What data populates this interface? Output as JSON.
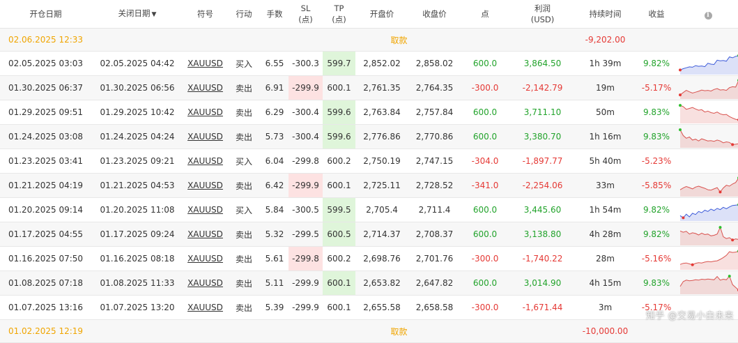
{
  "headers": {
    "open_date": "开仓日期",
    "close_date": "关闭日期",
    "close_date_sort_icon": "caret-down-icon",
    "symbol": "符号",
    "action": "行动",
    "lots": "手数",
    "sl_line1": "SL",
    "sl_line2": "(点)",
    "tp_line1": "TP",
    "tp_line2": "(点)",
    "open_price": "开盘价",
    "close_price": "收盘价",
    "points": "点",
    "profit_line1": "利润",
    "profit_line2": "(USD)",
    "duration": "持续时间",
    "gain": "收益",
    "info_icon": "info-icon",
    "info_glyph": "i"
  },
  "colors": {
    "positive": "#22a32b",
    "negative": "#e53935",
    "pending": "#f0a500",
    "sl_highlight": "#fde2e2",
    "tp_highlight": "#dff5da",
    "sparkline_up": "#3d5bd9",
    "sparkline_down": "#d9534f"
  },
  "pending_top": {
    "open": "02.06.2025 12:33",
    "action": "取款",
    "profit": "-9,202.00",
    "icon": "chat-bubble-icon"
  },
  "trades": [
    {
      "open": "02.05.2025 03:03",
      "close": "02.05.2025 04:42",
      "symbol": "XAUUSD",
      "action": "买入",
      "lots": "6.55",
      "sl": "-300.3",
      "tp": "599.7",
      "open_price": "2,852.02",
      "close_price": "2,858.02",
      "points": "600.0",
      "profit": "3,864.50",
      "duration": "1h 39m",
      "gain": "9.82%",
      "result": "tp",
      "spark": [
        0.18,
        0.25,
        0.3,
        0.35,
        0.33,
        0.42,
        0.38,
        0.4,
        0.36,
        0.55,
        0.5,
        0.48,
        0.72,
        0.68,
        0.7,
        0.66,
        0.9,
        0.85,
        0.93,
        0.97
      ]
    },
    {
      "open": "01.30.2025 06:37",
      "close": "01.30.2025 06:56",
      "symbol": "XAUUSD",
      "action": "卖出",
      "lots": "6.91",
      "sl": "-299.9",
      "tp": "600.1",
      "open_price": "2,761.35",
      "close_price": "2,764.35",
      "points": "-300.0",
      "profit": "-2,142.79",
      "duration": "19m",
      "gain": "-5.17%",
      "result": "sl",
      "spark": [
        0.15,
        0.28,
        0.4,
        0.32,
        0.25,
        0.3,
        0.35,
        0.42,
        0.38,
        0.4,
        0.36,
        0.45,
        0.5,
        0.42,
        0.44,
        0.4,
        0.55,
        0.6,
        0.58,
        0.95
      ]
    },
    {
      "open": "01.29.2025 09:51",
      "close": "01.29.2025 10:42",
      "symbol": "XAUUSD",
      "action": "卖出",
      "lots": "6.29",
      "sl": "-300.4",
      "tp": "599.6",
      "open_price": "2,763.84",
      "close_price": "2,757.84",
      "points": "600.0",
      "profit": "3,711.10",
      "duration": "50m",
      "gain": "9.83%",
      "result": "tp",
      "spark": [
        0.92,
        0.85,
        0.7,
        0.75,
        0.8,
        0.72,
        0.65,
        0.68,
        0.55,
        0.6,
        0.52,
        0.48,
        0.55,
        0.45,
        0.4,
        0.42,
        0.3,
        0.22,
        0.15,
        0.12
      ]
    },
    {
      "open": "01.24.2025 03:08",
      "close": "01.24.2025 04:24",
      "symbol": "XAUUSD",
      "action": "卖出",
      "lots": "5.73",
      "sl": "-300.4",
      "tp": "599.6",
      "open_price": "2,776.86",
      "close_price": "2,770.86",
      "points": "600.0",
      "profit": "3,380.70",
      "duration": "1h 16m",
      "gain": "9.83%",
      "result": "tp",
      "spark": [
        0.92,
        0.6,
        0.45,
        0.52,
        0.35,
        0.4,
        0.3,
        0.42,
        0.36,
        0.3,
        0.32,
        0.28,
        0.35,
        0.3,
        0.2,
        0.25,
        0.22,
        0.1,
        0.12,
        0.15
      ]
    },
    {
      "open": "01.23.2025 03:41",
      "close": "01.23.2025 09:21",
      "symbol": "XAUUSD",
      "action": "买入",
      "lots": "6.04",
      "sl": "-299.8",
      "tp": "600.2",
      "open_price": "2,750.19",
      "close_price": "2,747.15",
      "points": "-304.0",
      "profit": "-1,897.77",
      "duration": "5h 40m",
      "gain": "-5.23%",
      "result": "none",
      "spark": []
    },
    {
      "open": "01.21.2025 04:19",
      "close": "01.21.2025 04:53",
      "symbol": "XAUUSD",
      "action": "卖出",
      "lots": "6.42",
      "sl": "-299.9",
      "tp": "600.1",
      "open_price": "2,725.11",
      "close_price": "2,728.52",
      "points": "-341.0",
      "profit": "-2,254.06",
      "duration": "33m",
      "gain": "-5.85%",
      "result": "sl",
      "spark": [
        0.3,
        0.4,
        0.48,
        0.42,
        0.35,
        0.45,
        0.5,
        0.44,
        0.38,
        0.3,
        0.28,
        0.35,
        0.42,
        0.18,
        0.4,
        0.55,
        0.5,
        0.62,
        0.7,
        0.95
      ]
    },
    {
      "open": "01.20.2025 09:14",
      "close": "01.20.2025 11:08",
      "symbol": "XAUUSD",
      "action": "买入",
      "lots": "5.84",
      "sl": "-300.5",
      "tp": "599.5",
      "open_price": "2,705.4",
      "close_price": "2,711.4",
      "points": "600.0",
      "profit": "3,445.60",
      "duration": "1h 54m",
      "gain": "9.82%",
      "result": "tp",
      "spark": [
        0.22,
        0.1,
        0.3,
        0.15,
        0.35,
        0.28,
        0.45,
        0.38,
        0.52,
        0.45,
        0.58,
        0.5,
        0.62,
        0.55,
        0.68,
        0.6,
        0.7,
        0.78,
        0.8,
        0.82
      ]
    },
    {
      "open": "01.17.2025 04:55",
      "close": "01.17.2025 09:24",
      "symbol": "XAUUSD",
      "action": "卖出",
      "lots": "5.32",
      "sl": "-299.5",
      "tp": "600.5",
      "open_price": "2,714.37",
      "close_price": "2,708.37",
      "points": "600.0",
      "profit": "3,138.80",
      "duration": "4h 28m",
      "gain": "9.82%",
      "result": "tp",
      "spark": [
        0.72,
        0.65,
        0.7,
        0.55,
        0.62,
        0.58,
        0.5,
        0.6,
        0.52,
        0.55,
        0.45,
        0.48,
        0.55,
        0.92,
        0.4,
        0.3,
        0.35,
        0.22,
        0.28,
        0.25
      ]
    },
    {
      "open": "01.16.2025 07:50",
      "close": "01.16.2025 08:18",
      "symbol": "XAUUSD",
      "action": "卖出",
      "lots": "5.61",
      "sl": "-299.8",
      "tp": "600.2",
      "open_price": "2,698.76",
      "close_price": "2,701.76",
      "points": "-300.0",
      "profit": "-1,740.22",
      "duration": "28m",
      "gain": "-5.16%",
      "result": "sl",
      "spark": [
        0.22,
        0.28,
        0.3,
        0.25,
        0.2,
        0.28,
        0.32,
        0.3,
        0.35,
        0.38,
        0.36,
        0.4,
        0.42,
        0.5,
        0.6,
        0.72,
        0.92,
        0.88,
        0.9,
        0.95
      ]
    },
    {
      "open": "01.08.2025 07:18",
      "close": "01.08.2025 11:33",
      "symbol": "XAUUSD",
      "action": "卖出",
      "lots": "5.11",
      "sl": "-299.9",
      "tp": "600.1",
      "open_price": "2,653.82",
      "close_price": "2,647.82",
      "points": "600.0",
      "profit": "3,014.90",
      "duration": "4h 15m",
      "gain": "9.83%",
      "result": "tp",
      "spark": [
        0.35,
        0.62,
        0.7,
        0.66,
        0.68,
        0.72,
        0.7,
        0.75,
        0.73,
        0.76,
        0.74,
        0.72,
        0.9,
        0.7,
        0.75,
        0.72,
        0.92,
        0.45,
        0.3,
        0.15
      ]
    },
    {
      "open": "01.07.2025 13:16",
      "close": "01.07.2025 13:20",
      "symbol": "XAUUSD",
      "action": "卖出",
      "lots": "5.39",
      "sl": "-299.9",
      "tp": "600.1",
      "open_price": "2,655.58",
      "close_price": "2,658.58",
      "points": "-300.0",
      "profit": "-1,671.44",
      "duration": "3m",
      "gain": "-5.17%",
      "result": "none",
      "spark": []
    }
  ],
  "pending_bottom": {
    "open": "01.02.2025 12:19",
    "action": "取款",
    "profit": "-10,000.00"
  },
  "watermark": "知乎 @交易小白未来"
}
